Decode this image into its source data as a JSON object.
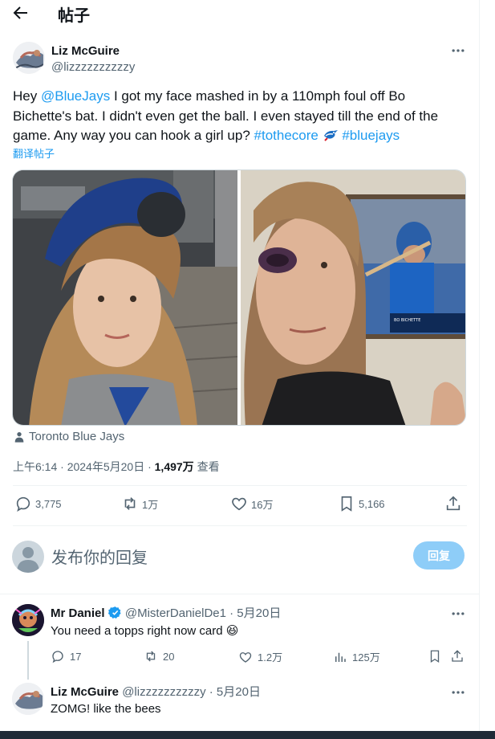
{
  "header": {
    "title": "帖子"
  },
  "tweet": {
    "author_name": "Liz McGuire",
    "author_handle": "@lizzzzzzzzzzy",
    "text_parts": {
      "p1": "Hey ",
      "mention": "@BlueJays",
      "p2": "  I got my face mashed in by a 110mph foul off Bo Bichette's bat. I didn't even get the ball. I even stayed till the end of the game. Any way you can hook a girl up? ",
      "hashtag1": "#tothecore",
      "hashtag2": "#bluejays"
    },
    "translate_label": "翻译帖子",
    "location": "Toronto Blue Jays",
    "time": "上午6:14 · 2024年5月20日 · ",
    "views_count": "1,497万",
    "views_label": " 查看",
    "stats": {
      "replies": "3,775",
      "retweets": "1万",
      "likes": "16万",
      "bookmarks": "5,166"
    },
    "media": {
      "scoreboard": "BO BICHETTE"
    }
  },
  "composer": {
    "placeholder": "发布你的回复",
    "button_label": "回复"
  },
  "replies": [
    {
      "name": "Mr Daniel",
      "handle": "@MisterDanielDe1",
      "date": " · 5月20日",
      "text": "You need a topps right now card 😆",
      "stats": {
        "replies": "17",
        "retweets": "20",
        "likes": "1.2万",
        "views": "125万"
      }
    },
    {
      "name": "Liz McGuire",
      "handle": "@lizzzzzzzzzzy",
      "date": " · 5月20日",
      "text": "ZOMG! like the bees"
    }
  ],
  "colors": {
    "accent": "#1d9bf0",
    "muted": "#536471",
    "text": "#0f1419",
    "button_disabled": "#8ecdf8"
  }
}
